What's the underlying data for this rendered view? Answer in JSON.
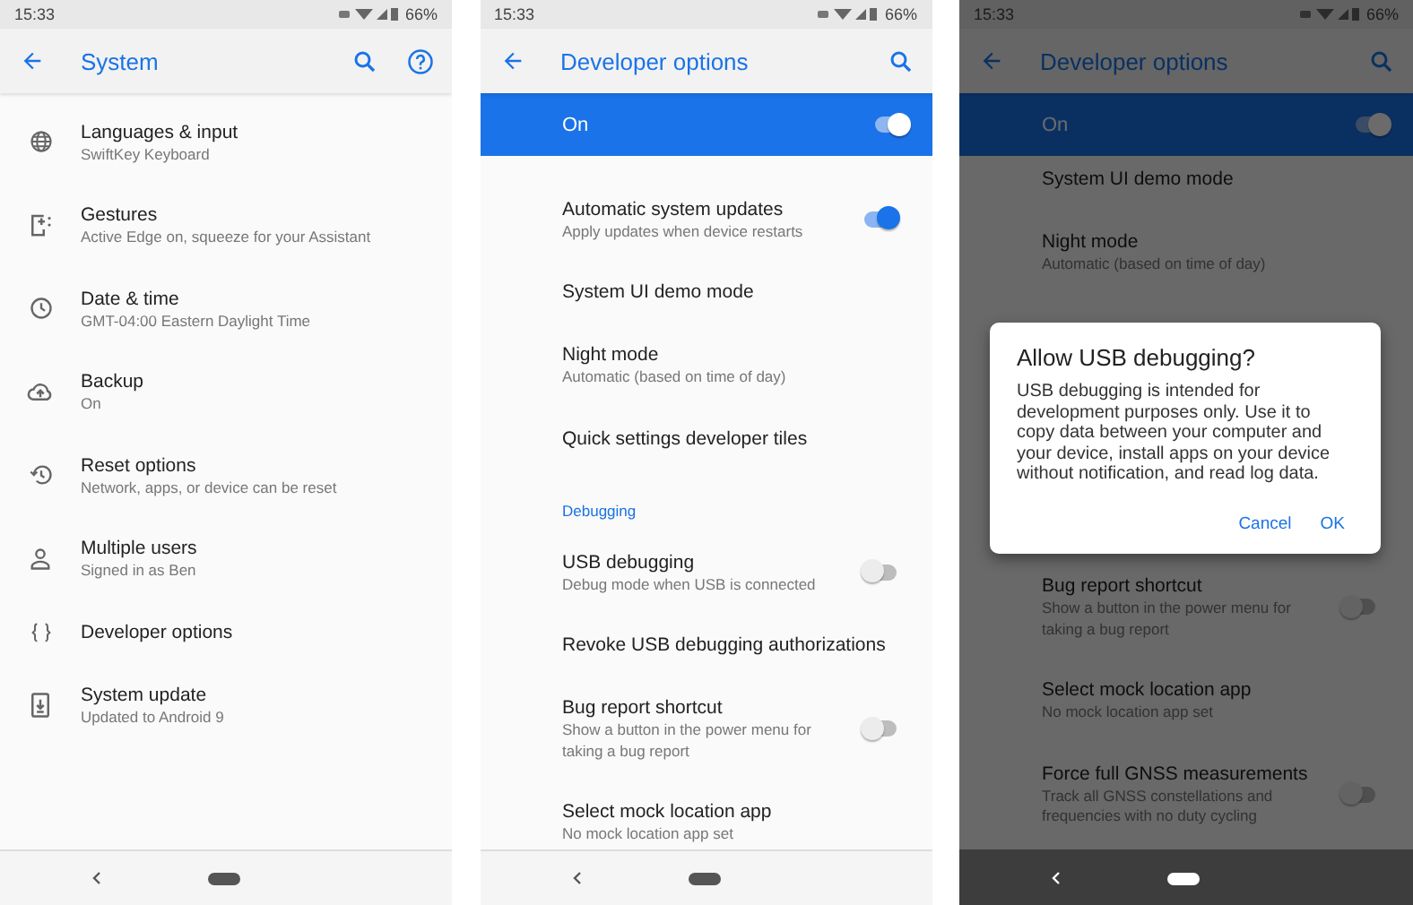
{
  "screens": [
    {
      "status_bar": {
        "time": "15:33",
        "battery": "66%"
      },
      "app_bar": {
        "title": "System",
        "help_button": true
      },
      "items": [
        {
          "kind": "icon_setting",
          "title": "Languages & input",
          "subtitle": "SwiftKey Keyboard"
        },
        {
          "kind": "icon_setting",
          "title": "Gestures",
          "subtitle": "Active Edge on, squeeze for your Assistant"
        },
        {
          "kind": "icon_setting",
          "title": "Date & time",
          "subtitle": "GMT-04:00 Eastern Daylight Time"
        },
        {
          "kind": "icon_setting",
          "title": "Backup",
          "subtitle": "On"
        },
        {
          "kind": "icon_setting",
          "title": "Reset options",
          "subtitle": "Network, apps, or device can be reset"
        },
        {
          "kind": "icon_setting",
          "title": "Multiple users",
          "subtitle": "Signed in as Ben"
        },
        {
          "kind": "icon_setting",
          "title": "Developer options"
        },
        {
          "kind": "icon_setting",
          "title": "System update",
          "subtitle": "Updated to Android 9"
        }
      ]
    },
    {
      "status_bar": {
        "time": "15:33",
        "battery": "66%"
      },
      "app_bar": {
        "title": "Developer options"
      },
      "master_switch": {
        "label": "On",
        "on": true
      },
      "items": [
        {
          "kind": "toggle",
          "title": "Automatic system updates",
          "subtitle": "Apply updates when device restarts",
          "on": true
        },
        {
          "kind": "setting",
          "title": "System UI demo mode"
        },
        {
          "kind": "setting",
          "title": "Night mode",
          "subtitle": "Automatic (based on time of day)"
        },
        {
          "kind": "setting",
          "title": "Quick settings developer tiles"
        },
        {
          "kind": "divider"
        },
        {
          "kind": "header",
          "title": "Debugging"
        },
        {
          "kind": "toggle",
          "title": "USB debugging",
          "subtitle": "Debug mode when USB is connected",
          "on": false
        },
        {
          "kind": "setting",
          "title": "Revoke USB debugging authorizations"
        },
        {
          "kind": "toggle",
          "title": "Bug report shortcut",
          "subtitle": "Show a button in the power menu for taking a bug report",
          "on": false
        },
        {
          "kind": "setting",
          "title": "Select mock location app",
          "subtitle": "No mock location app set"
        }
      ]
    },
    {
      "dimmed": true,
      "status_bar": {
        "time": "15:33",
        "battery": "66%"
      },
      "app_bar": {
        "title": "Developer options"
      },
      "master_switch": {
        "label": "On",
        "on": true
      },
      "items": [
        {
          "kind": "setting",
          "title": "System UI demo mode"
        },
        {
          "kind": "setting",
          "title": "Night mode",
          "subtitle": "Automatic (based on time of day)"
        },
        {
          "kind": "covered"
        },
        {
          "kind": "toggle",
          "title": "Bug report shortcut",
          "subtitle": "Show a button in the power menu for taking a bug report",
          "on": false
        },
        {
          "kind": "setting",
          "title": "Select mock location app",
          "subtitle": "No mock location app set"
        },
        {
          "kind": "toggle",
          "title": "Force full GNSS measurements",
          "subtitle": "Track all GNSS constellations and frequencies with no duty cycling",
          "on": false
        }
      ],
      "dialog": {
        "title": "Allow USB debugging?",
        "body": "USB debugging is intended for development purposes only. Use it to copy data between your computer and your device, install apps on your device without notification, and read log data.",
        "buttons": [
          "Cancel",
          "OK"
        ]
      }
    }
  ]
}
